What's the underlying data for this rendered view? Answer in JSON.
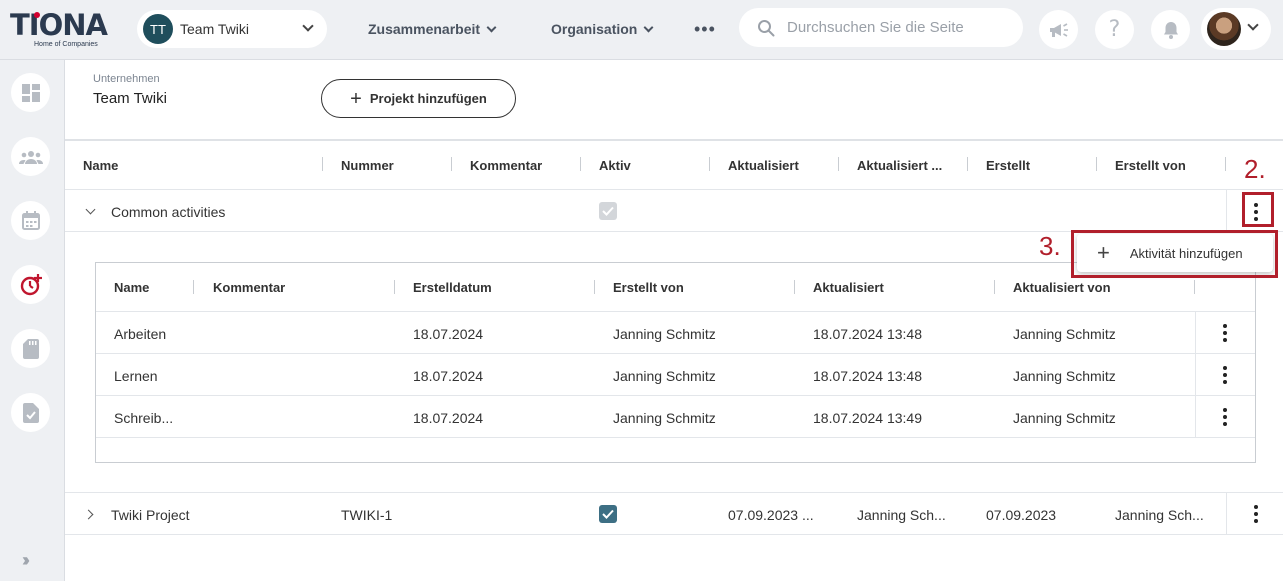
{
  "logo": {
    "text": "TIONA",
    "subtitle": "Home of Companies"
  },
  "topbar": {
    "team_initials": "TT",
    "team_name": "Team Twiki",
    "nav": [
      "Zusammenarbeit",
      "Organisation"
    ],
    "more_label": "•••",
    "search_placeholder": "Durchsuchen Sie die Seite"
  },
  "header": {
    "label": "Unternehmen",
    "title": "Team Twiki",
    "add_project": "Projekt hinzufügen"
  },
  "main_table": {
    "columns": [
      "Name",
      "Nummer",
      "Kommentar",
      "Aktiv",
      "Aktualisiert",
      "Aktualisiert ...",
      "Erstellt",
      "Erstellt von"
    ],
    "rows": [
      {
        "name": "Common activities",
        "nummer": "",
        "kommentar": "",
        "aktiv": true,
        "aktualisiert": "",
        "aktualisiert_von": "",
        "erstellt": "",
        "erstellt_von": "",
        "expanded": true
      },
      {
        "name": "Twiki Project",
        "nummer": "TWIKI-1",
        "kommentar": "",
        "aktiv": true,
        "aktualisiert": "07.09.2023 ...",
        "aktualisiert_von": "Janning Sch...",
        "erstellt": "07.09.2023",
        "erstellt_von": "Janning Sch...",
        "expanded": false
      }
    ]
  },
  "nested_table": {
    "columns": [
      "Name",
      "Kommentar",
      "Erstelldatum",
      "Erstellt von",
      "Aktualisiert",
      "Aktualisiert von"
    ],
    "rows": [
      {
        "name": "Arbeiten",
        "kommentar": "",
        "erstelldatum": "18.07.2024",
        "erstellt_von": "Janning Schmitz",
        "aktualisiert": "18.07.2024 13:48",
        "aktualisiert_von": "Janning Schmitz"
      },
      {
        "name": "Lernen",
        "kommentar": "",
        "erstelldatum": "18.07.2024",
        "erstellt_von": "Janning Schmitz",
        "aktualisiert": "18.07.2024 13:48",
        "aktualisiert_von": "Janning Schmitz"
      },
      {
        "name": "Schreib...",
        "kommentar": "",
        "erstelldatum": "18.07.2024",
        "erstellt_von": "Janning Schmitz",
        "aktualisiert": "18.07.2024 13:49",
        "aktualisiert_von": "Janning Schmitz"
      }
    ]
  },
  "popup": {
    "add_activity": "Aktivität hinzufügen"
  },
  "annotations": {
    "step2": "2.",
    "step3": "3."
  },
  "colors": {
    "accent_red": "#b11f2b",
    "checkbox_active": "#3d6f84",
    "checkbox_disabled": "#d3d6da",
    "brand_red": "#d3002f"
  }
}
